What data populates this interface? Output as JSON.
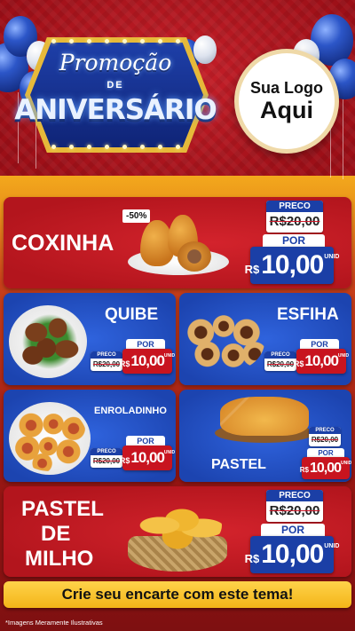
{
  "header": {
    "promo_line1": "Promoção",
    "promo_de": "DE",
    "promo_line2": "ANIVERSÁRIO",
    "logo_line1": "Sua Logo",
    "logo_line2": "Aqui"
  },
  "products": {
    "coxinha": {
      "name": "COXINHA",
      "badge": "-50%",
      "old_label": "PRECO",
      "old_price": "R$20,00",
      "por": "POR",
      "currency": "R$",
      "new_price": "10,00",
      "unit": "UNID"
    },
    "quibe": {
      "name": "QUIBE",
      "old_label": "PRECO",
      "old_price": "R$20,00",
      "por": "POR",
      "currency": "R$",
      "new_price": "10,00",
      "unit": "UNID"
    },
    "esfiha": {
      "name": "ESFIHA",
      "old_label": "PRECO",
      "old_price": "R$20,00",
      "por": "POR",
      "currency": "R$",
      "new_price": "10,00",
      "unit": "UNID"
    },
    "enroladinho": {
      "name": "ENROLADINHO",
      "old_label": "PRECO",
      "old_price": "R$20,00",
      "por": "POR",
      "currency": "R$",
      "new_price": "10,00",
      "unit": "UNID"
    },
    "pastel": {
      "name": "PASTEL",
      "old_label": "PRECO",
      "old_price": "R$20,00",
      "por": "POR",
      "currency": "R$",
      "new_price": "10,00",
      "unit": "UNID"
    },
    "pastel_milho": {
      "name_line1": "PASTEL",
      "name_line2": "DE",
      "name_line3": "MILHO",
      "old_label": "PRECO",
      "old_price": "R$20,00",
      "por": "POR",
      "currency": "R$",
      "new_price": "10,00",
      "unit": "UNID"
    }
  },
  "banner": {
    "text": "Crie seu encarte com este tema!"
  },
  "footnote": "*Imagens Meramente Ilustrativas",
  "colors": {
    "red": "#c8141f",
    "blue": "#1b3fa6",
    "yellow": "#f3b518"
  }
}
